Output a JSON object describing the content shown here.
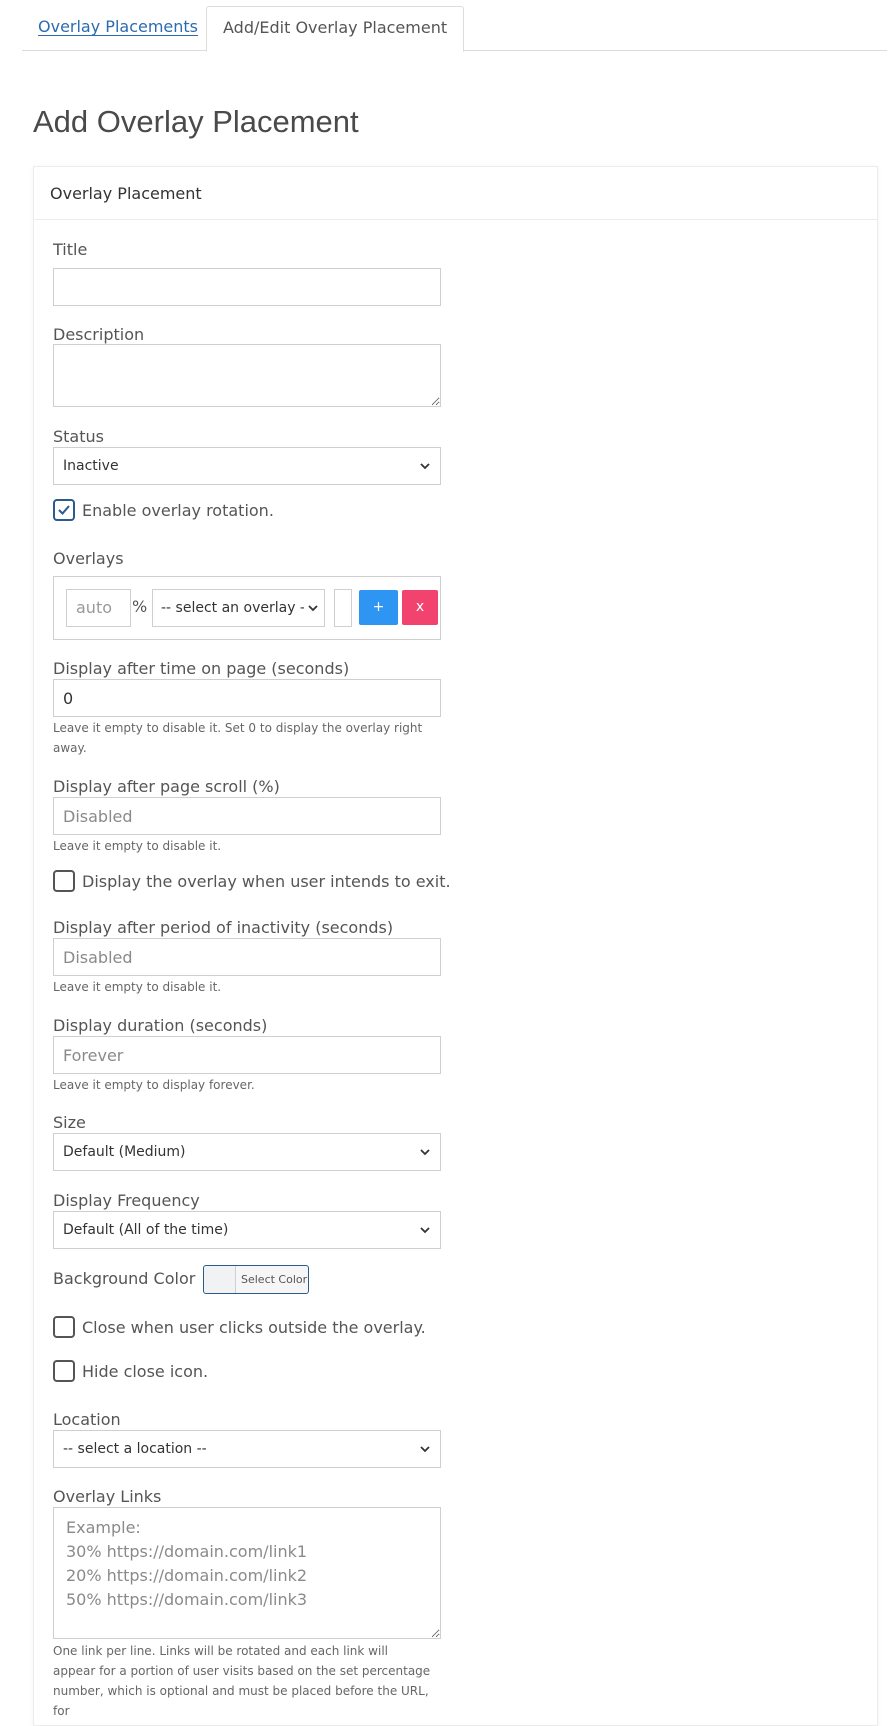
{
  "tabs": {
    "overlay_placements": "Overlay Placements",
    "add_edit": "Add/Edit Overlay Placement"
  },
  "page_title": "Add Overlay Placement",
  "card_title": "Overlay Placement",
  "form": {
    "title": {
      "label": "Title",
      "value": ""
    },
    "description": {
      "label": "Description",
      "value": ""
    },
    "status": {
      "label": "Status",
      "selected": "Inactive"
    },
    "rotation": {
      "label": "Enable overlay rotation.",
      "checked": true
    },
    "overlays": {
      "label": "Overlays",
      "percent_placeholder": "auto",
      "percent_symbol": "%",
      "select_placeholder": "-- select an overlay --",
      "add_label": "+",
      "remove_label": "x"
    },
    "time_on_page": {
      "label": "Display after time on page (seconds)",
      "value": "0",
      "help": "Leave it empty to disable it. Set 0 to display the overlay right away."
    },
    "page_scroll": {
      "label": "Display after page scroll (%)",
      "placeholder": "Disabled",
      "help": "Leave it empty to disable it."
    },
    "exit_intent": {
      "label": "Display the overlay when user intends to exit.",
      "checked": false
    },
    "inactivity": {
      "label": "Display after period of inactivity (seconds)",
      "placeholder": "Disabled",
      "help": "Leave it empty to disable it."
    },
    "duration": {
      "label": "Display duration (seconds)",
      "placeholder": "Forever",
      "help": "Leave it empty to display forever."
    },
    "size": {
      "label": "Size",
      "selected": "Default (Medium)"
    },
    "frequency": {
      "label": "Display Frequency",
      "selected": "Default (All of the time)"
    },
    "background_color": {
      "label": "Background Color",
      "button_label": "Select Color"
    },
    "close_outside": {
      "label": "Close when user clicks outside the overlay.",
      "checked": false
    },
    "hide_close": {
      "label": "Hide close icon.",
      "checked": false
    },
    "location": {
      "label": "Location",
      "selected": "-- select a location --"
    },
    "overlay_links": {
      "label": "Overlay Links",
      "placeholder": "Example:\n30% https://domain.com/link1\n20% https://domain.com/link2\n50% https://domain.com/link3",
      "help": "One link per line. Links will be rotated and each link will appear for a portion of user visits based on the set percentage number, which is optional and must be placed before the URL, for"
    }
  },
  "colors": {
    "link": "#2b6cb0",
    "add_button": "#2f95f2",
    "remove_button": "#f2436f",
    "checkbox_checked": "#2b5b8e"
  }
}
